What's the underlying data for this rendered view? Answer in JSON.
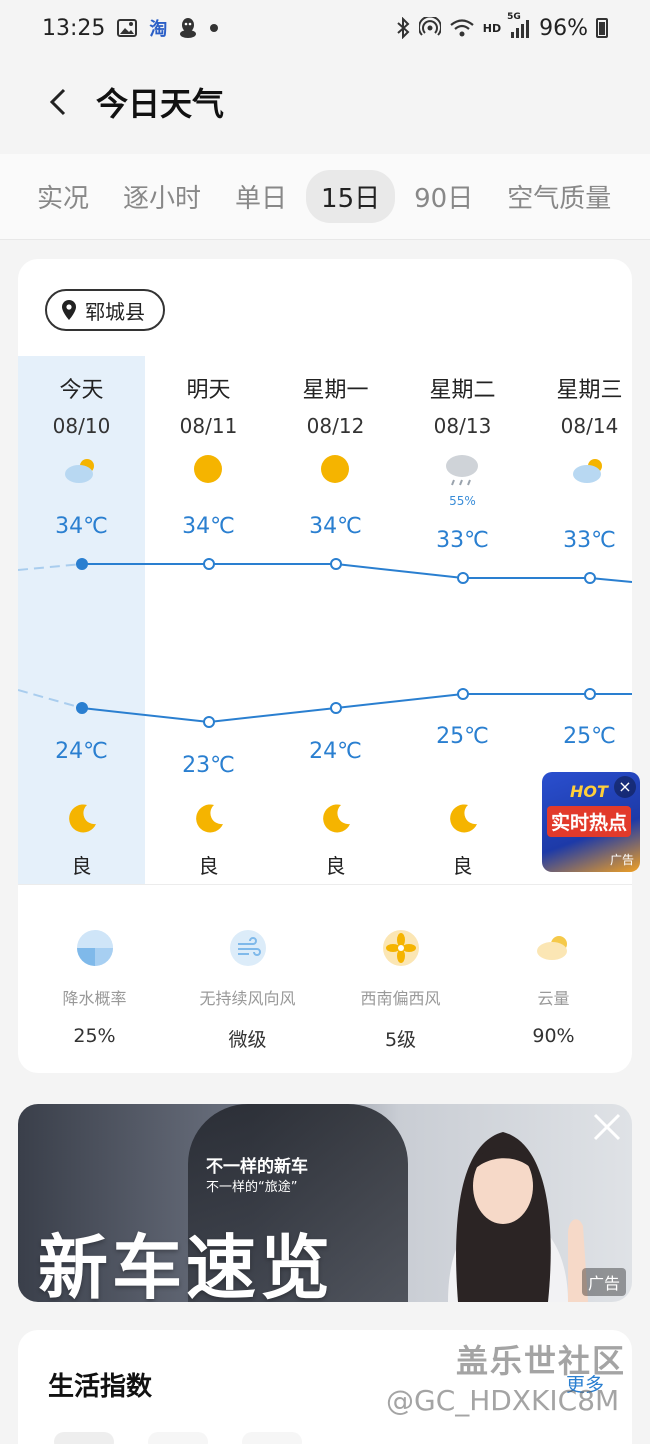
{
  "status_bar": {
    "time": "13:25",
    "app_icons": [
      "gallery-icon",
      "taobao-icon",
      "qq-icon",
      "dot-icon"
    ],
    "battery": "96%",
    "hd_label": "HD",
    "network_label": "5G"
  },
  "header": {
    "title": "今日天气"
  },
  "tabs": [
    {
      "label": "实况",
      "active": false
    },
    {
      "label": "逐小时",
      "active": false
    },
    {
      "label": "单日",
      "active": false
    },
    {
      "label": "15日",
      "active": true
    },
    {
      "label": "90日",
      "active": false
    },
    {
      "label": "空气质量",
      "active": false
    }
  ],
  "location": {
    "name": "郓城县"
  },
  "forecast": {
    "days": [
      {
        "name": "今天",
        "date": "08/10",
        "icon": "partly-cloudy-icon",
        "precip": "",
        "high": "34℃",
        "low": "24℃",
        "night_icon": "moon-icon",
        "aqi": "良",
        "today": true
      },
      {
        "name": "明天",
        "date": "08/11",
        "icon": "sun-icon",
        "precip": "",
        "high": "34℃",
        "low": "23℃",
        "night_icon": "moon-icon",
        "aqi": "良",
        "today": false
      },
      {
        "name": "星期一",
        "date": "08/12",
        "icon": "sun-icon",
        "precip": "",
        "high": "34℃",
        "low": "24℃",
        "night_icon": "moon-icon",
        "aqi": "良",
        "today": false
      },
      {
        "name": "星期二",
        "date": "08/13",
        "icon": "rain-cloud-icon",
        "precip": "55%",
        "high": "33℃",
        "low": "25℃",
        "night_icon": "moon-icon",
        "aqi": "良",
        "today": false
      },
      {
        "name": "星期三",
        "date": "08/14",
        "icon": "partly-cloudy-icon",
        "precip": "",
        "high": "33℃",
        "low": "25℃",
        "night_icon": "moon-icon",
        "aqi": "",
        "today": false
      }
    ],
    "high_values": [
      34,
      34,
      34,
      33,
      33
    ],
    "low_values": [
      24,
      23,
      24,
      25,
      25
    ]
  },
  "details": [
    {
      "icon": "precipitation-icon",
      "label": "降水概率",
      "value": "25%"
    },
    {
      "icon": "wind-icon",
      "label": "无持续风向风",
      "value": "微级"
    },
    {
      "icon": "fan-icon",
      "label": "西南偏西风",
      "value": "5级"
    },
    {
      "icon": "cloud-icon",
      "label": "云量",
      "value": "90%"
    }
  ],
  "float_ad": {
    "hot_word": "HOT",
    "main_text": "实时热点",
    "tag": "广告"
  },
  "banner_ad": {
    "subtitle1": "不一样的新车",
    "subtitle2": "不一样的“旅途”",
    "main_text": "新车速览",
    "tag": "广告"
  },
  "life_index": {
    "title": "生活指数",
    "more": "更多"
  },
  "watermark": {
    "line1": "盖乐世社区",
    "line2": "@GC_HDXKIC8M"
  },
  "colors": {
    "accent": "#2a7fd0",
    "today_bg": "#e5f0fa",
    "sun": "#f5b400"
  }
}
